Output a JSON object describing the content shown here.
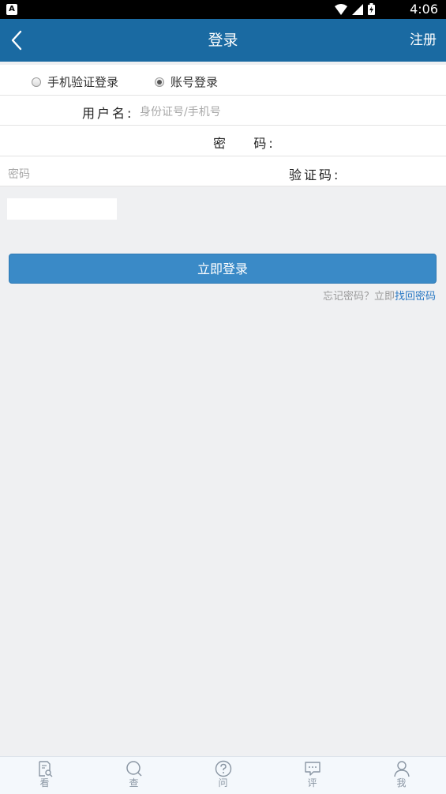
{
  "status_bar": {
    "time": "4:06",
    "notification_badge": "A"
  },
  "app_bar": {
    "title": "登录",
    "register_label": "注册"
  },
  "login_modes": [
    {
      "label": "手机验证登录",
      "selected": false
    },
    {
      "label": "账号登录",
      "selected": true
    }
  ],
  "form": {
    "username_label": "用户名:",
    "username_placeholder": "身份证号/手机号",
    "password_label": "密    码:",
    "password_placeholder": "密码",
    "captcha_label": "验证码:"
  },
  "login_button": "立即登录",
  "forgot": {
    "prefix": "忘记密码？立即",
    "link": "找回密码"
  },
  "tabs": [
    {
      "label": "看",
      "icon": "document-search-icon"
    },
    {
      "label": "查",
      "icon": "search-icon"
    },
    {
      "label": "问",
      "icon": "question-icon"
    },
    {
      "label": "评",
      "icon": "comment-icon"
    },
    {
      "label": "我",
      "icon": "user-icon"
    }
  ],
  "colors": {
    "primary": "#1a6aa2",
    "button": "#3a8ac7",
    "link": "#2a79c4",
    "background": "#eff0f2"
  }
}
